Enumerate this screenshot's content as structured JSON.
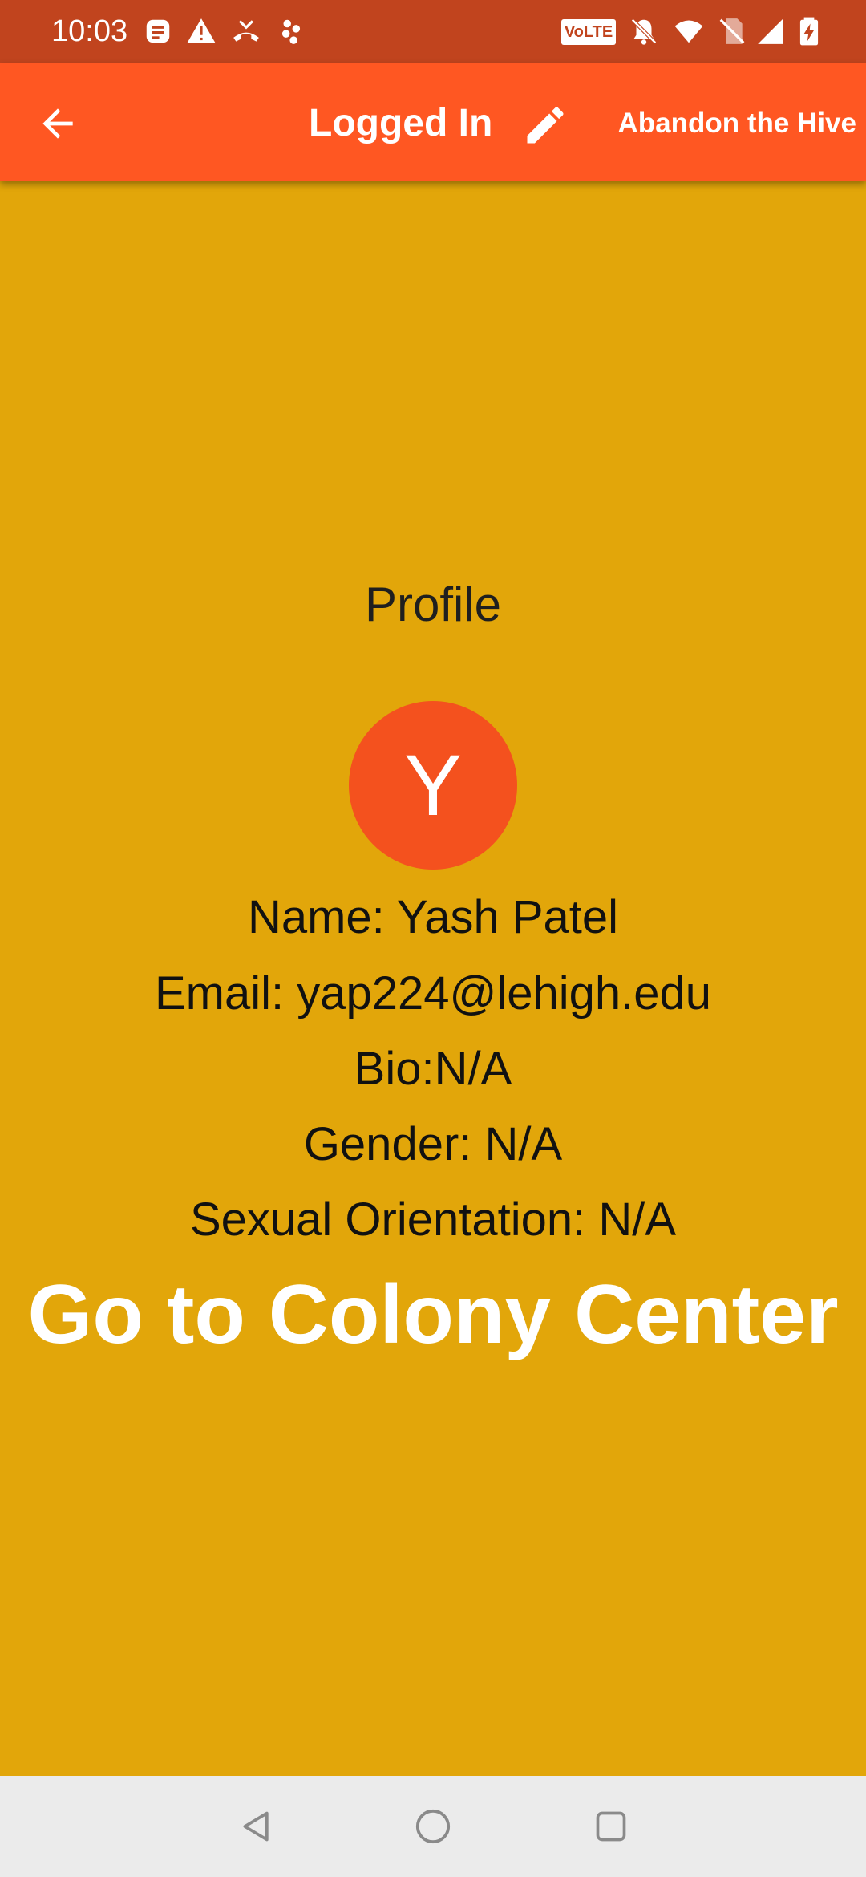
{
  "status_bar": {
    "time": "10:03",
    "volte_label": "VoLTE",
    "left_icons": [
      "notification-app-icon",
      "warning-icon",
      "missed-call-icon",
      "app-notification-icon"
    ],
    "right_icons": [
      "volte-icon",
      "notifications-off-icon",
      "wifi-icon",
      "no-sim-icon",
      "signal-icon",
      "battery-charging-icon"
    ],
    "color": "#C1441E"
  },
  "app_bar": {
    "title": "Logged In",
    "back_icon": "arrow-back-icon",
    "edit_icon": "pencil-icon",
    "action_label": "Abandon the Hive",
    "color": "#FF5722"
  },
  "profile": {
    "heading": "Profile",
    "avatar_letter": "Y",
    "avatar_color": "#F4511E",
    "name": "Name: Yash Patel",
    "email": "Email: yap224@lehigh.edu",
    "bio": "Bio:N/A",
    "gender": "Gender: N/A",
    "orientation": "Sexual Orientation: N/A"
  },
  "colony_button": {
    "label": "Go to Colony Center"
  },
  "background_color": "#E2A60A",
  "nav_bar": {
    "icons": [
      "nav-back-icon",
      "nav-home-icon",
      "nav-recents-icon"
    ],
    "color": "#EBEBEB"
  }
}
